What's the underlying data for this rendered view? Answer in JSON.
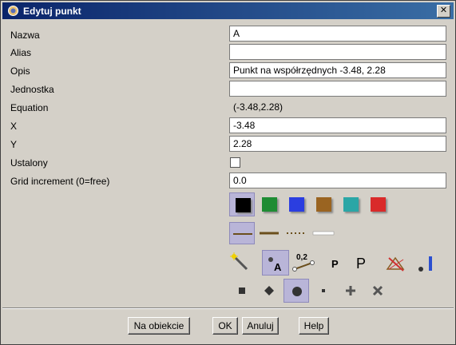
{
  "window": {
    "title": "Edytuj punkt",
    "close_label": "✕"
  },
  "form": {
    "name_label": "Nazwa",
    "name_value": "A",
    "alias_label": "Alias",
    "alias_value": "",
    "description_label": "Opis",
    "description_value": "Punkt na współrzędnych -3.48, 2.28",
    "unit_label": "Jednostka",
    "unit_value": "",
    "equation_label": "Equation",
    "equation_value": "(-3.48,2.28)",
    "x_label": "X",
    "x_value": "-3.48",
    "y_label": "Y",
    "y_value": "2.28",
    "fixed_label": "Ustalony",
    "fixed_checked": false,
    "grid_label": "Grid increment (0=free)",
    "grid_value": "0.0"
  },
  "colors": [
    "#000000",
    "#1e8c33",
    "#2b3ee0",
    "#9a6421",
    "#2ba6a6",
    "#d92a2a"
  ],
  "selected_color": 0,
  "line_styles": [
    "solid",
    "thick",
    "dotted",
    "thin"
  ],
  "selected_line_style": 0,
  "label_modes": {
    "value_text": "0,2",
    "p_text": "P"
  },
  "point_shapes": [
    "square",
    "diamond",
    "circle",
    "dot",
    "plus",
    "cross"
  ],
  "selected_point_shape": 2,
  "buttons": {
    "object_label": "Na obiekcie",
    "ok_label": "OK",
    "cancel_label": "Anuluj",
    "help_label": "Help"
  }
}
